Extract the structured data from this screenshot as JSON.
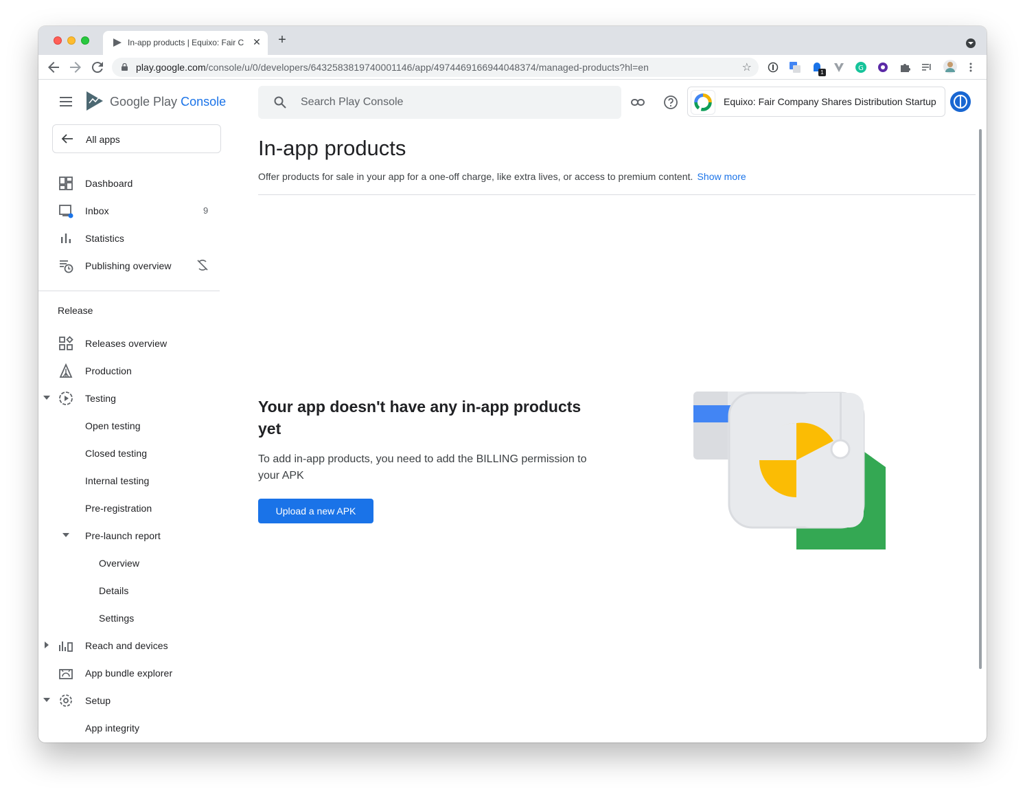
{
  "browser": {
    "tab_title": "In-app products | Equixo: Fair C",
    "tab_close": "✕",
    "new_tab": "+",
    "url_host": "play.google.com",
    "url_path": "/console/u/0/developers/6432583819740001146/app/4974469166944048374/managed-products?hl=en",
    "extension_badge": "1",
    "icons": [
      "back-icon",
      "forward-icon",
      "reload-icon",
      "lock-icon",
      "star-icon",
      "extension-icons",
      "profile-avatar",
      "more-icon"
    ]
  },
  "header": {
    "brand_google_play": "Google Play",
    "brand_console": "Console",
    "search_placeholder": "Search Play Console",
    "account_name": "Equixo: Fair Company Shares Distribution Startup"
  },
  "sidebar": {
    "all_apps": "All apps",
    "top_items": [
      {
        "label": "Dashboard",
        "icon": "dashboard-icon"
      },
      {
        "label": "Inbox",
        "icon": "inbox-icon",
        "badge": "9"
      },
      {
        "label": "Statistics",
        "icon": "statistics-icon"
      },
      {
        "label": "Publishing overview",
        "icon": "publishing-overview-icon"
      }
    ],
    "section_release": "Release",
    "release_items": [
      {
        "label": "Releases overview"
      },
      {
        "label": "Production"
      },
      {
        "label": "Testing"
      },
      {
        "label": "Open testing"
      },
      {
        "label": "Closed testing"
      },
      {
        "label": "Internal testing"
      },
      {
        "label": "Pre-registration"
      },
      {
        "label": "Pre-launch report"
      },
      {
        "label": "Overview"
      },
      {
        "label": "Details"
      },
      {
        "label": "Settings"
      },
      {
        "label": "Reach and devices"
      },
      {
        "label": "App bundle explorer"
      },
      {
        "label": "Setup"
      },
      {
        "label": "App integrity"
      }
    ]
  },
  "main": {
    "title": "In-app products",
    "description": "Offer products for sale in your app for a one-off charge, like extra lives, or access to premium content.",
    "show_more": "Show more",
    "empty_title": "Your app doesn't have any in-app products yet",
    "empty_desc": "To add in-app products, you need to add the BILLING permission to your APK",
    "upload_button": "Upload a new APK"
  },
  "colors": {
    "accent": "#1a73e8",
    "illustration_blue": "#4285f4",
    "illustration_yellow": "#fbbc04",
    "illustration_green": "#34a853",
    "illustration_grey": "#e8eaed"
  }
}
